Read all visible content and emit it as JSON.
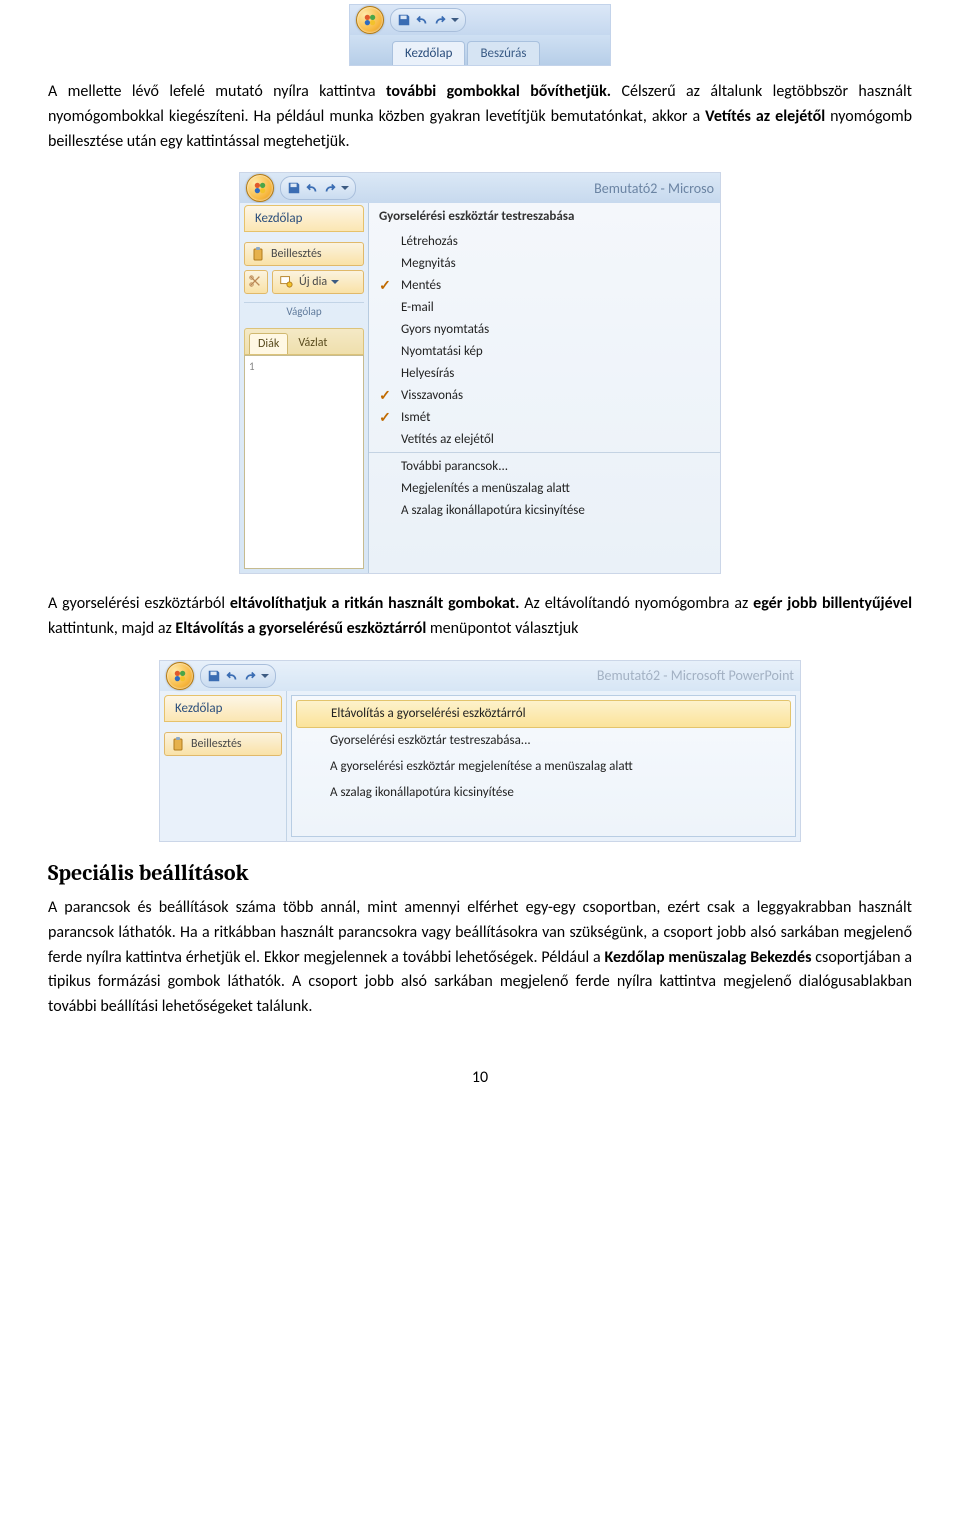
{
  "fig1": {
    "tabs": [
      "Kezdőlap",
      "Beszúrás"
    ]
  },
  "para1": {
    "t1": "A mellette lévő lefelé mutató nyílra kattintva ",
    "b1": "további gombokkal bővíthetjük.",
    "t2": " Célszerű az általunk legtöbbször használt nyomógombokkal kiegészíteni. Ha például munka közben gyakran levetítjük bemutatónkat, akkor a ",
    "b2": "Vetítés az elejétől",
    "t3": " nyomógomb beillesztése után egy kattintással megtehetjük."
  },
  "fig2": {
    "win_title": "Bemutató2 - Microso",
    "ribbon_tab": "Kezdőlap",
    "paste_label": "Beillesztés",
    "new_label": "Új dia",
    "group_label": "Vágólap",
    "subtabs": {
      "a": "Diák",
      "b": "Vázlat"
    },
    "dd_header": "Gyorselérési eszköztár testreszabása",
    "items": [
      {
        "chk": false,
        "label": "Létrehozás"
      },
      {
        "chk": false,
        "label": "Megnyitás"
      },
      {
        "chk": true,
        "label": "Mentés"
      },
      {
        "chk": false,
        "label": "E-mail"
      },
      {
        "chk": false,
        "label": "Gyors nyomtatás"
      },
      {
        "chk": false,
        "label": "Nyomtatási kép"
      },
      {
        "chk": false,
        "label": "Helyesírás"
      },
      {
        "chk": true,
        "label": "Visszavonás"
      },
      {
        "chk": true,
        "label": "Ismét"
      },
      {
        "chk": false,
        "label": "Vetítés az elejétől"
      }
    ],
    "extra": [
      "További parancsok...",
      "Megjelenítés a menüszalag alatt",
      "A szalag ikonállapotúra kicsinyítése"
    ]
  },
  "para2": {
    "t1": "A gyorselérési eszköztárból ",
    "b1": "eltávolíthatjuk a ritkán használt gombokat.",
    "t2": " Az eltávolítandó nyomógombra az ",
    "b2": "egér jobb billentyűjével",
    "t3": " kattintunk, majd az ",
    "b3": "Eltávolítás a gyorselérésű eszköztárról",
    "t4": " menüpontot választjuk"
  },
  "fig3": {
    "win_title": "Bemutató2 - Microsoft PowerPoint",
    "ribbon_tab": "Kezdőlap",
    "paste_label": "Beillesztés",
    "ctx": [
      "Eltávolítás a gyorselérési eszköztárról",
      "Gyorselérési eszköztár testreszabása...",
      "A gyorselérési eszköztár megjelenítése a menüszalag alatt",
      "A szalag ikonállapotúra kicsinyítése"
    ]
  },
  "sect_head": "Speciális beállítások",
  "para3": {
    "t1": "A parancsok és beállítások száma több annál, mint amennyi elférhet egy-egy csoportban, ezért csak a leggyakrabban használt parancsok láthatók. Ha a ritkábban használt parancsokra vagy beállításokra van szükségünk, a csoport jobb alsó sarkában megjelenő ferde nyílra kattintva érhetjük el. Ekkor megjelennek a további lehetőségek. Például a ",
    "b1": "Kezdőlap menüszalag Bekezdés",
    "t2": " csoportjában a tipikus formázási gombok láthatók. A csoport jobb alsó sarkában megjelenő ferde nyílra kattintva megjelenő dialógusablakban további beállítási lehetőségeket találunk."
  },
  "page_number": "10"
}
